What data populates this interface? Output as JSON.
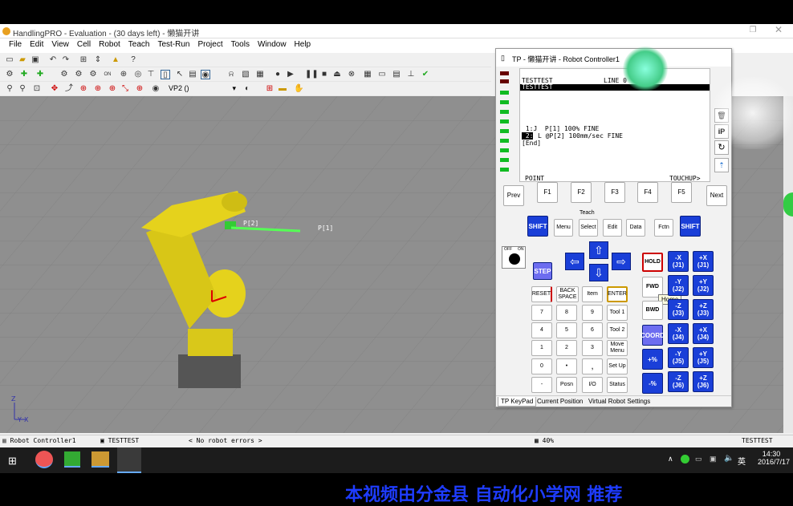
{
  "window": {
    "title": "HandlingPRO - Evaluation - (30 days left) - 懒猫开讲"
  },
  "menu": [
    "File",
    "Edit",
    "View",
    "Cell",
    "Robot",
    "Teach",
    "Test-Run",
    "Project",
    "Tools",
    "Window",
    "Help"
  ],
  "toolbar3": {
    "view_select": "VP2 ()"
  },
  "viewport": {
    "labels": {
      "p2": "P[2]",
      "p1": "P[1]",
      "axis_z": "Z",
      "axis_x": "X",
      "axis_y": "Y"
    }
  },
  "status": {
    "controller": "Robot Controller1",
    "program": "TESTTEST",
    "errors": "< No robot errors >",
    "zoom": "40%",
    "program_right": "TESTTEST"
  },
  "taskbar": {
    "time": "14:30",
    "date": "2016/7/17",
    "ime": "英"
  },
  "tp": {
    "title": "TP - 懒猫开讲 - Robot Controller1",
    "screen": {
      "line1": "TESTTEST",
      "line_label": "LINE 0",
      "line2": "TESTTEST",
      "code1": " 1:J  P[1] 100% FINE",
      "code2_num": " 2:",
      "code2": "L @P[2] 100mm/sec FINE",
      "end": "[End]",
      "point": "POINT",
      "touchup": "TOUCHUP>"
    },
    "fkeys": [
      "Prev",
      "F1",
      "F2",
      "F3",
      "F4",
      "F5",
      "Next"
    ],
    "teach_label": "Teach",
    "shift": "SHIFT",
    "menu_keys": [
      "Menu",
      "Select",
      "Edit",
      "Data",
      "Fctn"
    ],
    "onoff": {
      "off": "OFF",
      "on": "ON"
    },
    "step": "STEP",
    "hold": "HOLD",
    "fwd": "FWD",
    "bwd": "BWD",
    "coord": "COORD",
    "tooltip": "Home",
    "reset": "RESET",
    "backspace": "BACK SPACE",
    "item": "Item",
    "enter": "ENTER",
    "numpad": [
      [
        "7",
        "8",
        "9",
        "Tool 1"
      ],
      [
        "4",
        "5",
        "6",
        "Tool 2"
      ],
      [
        "1",
        "2",
        "3",
        "Move Menu"
      ],
      [
        "0",
        "•",
        ",",
        "Set Up"
      ],
      [
        "-",
        "Posn",
        "I/O",
        "Status"
      ]
    ],
    "jog": [
      [
        "-X\n(J1)",
        "+X\n(J1)"
      ],
      [
        "-Y\n(J2)",
        "+Y\n(J2)"
      ],
      [
        "-Z\n(J3)",
        "+Z\n(J3)"
      ],
      [
        "-X\n(J4)",
        "+X\n(J4)"
      ],
      [
        "-Y\n(J5)",
        "+Y\n(J5)"
      ],
      [
        "-Z\n(J6)",
        "+Z\n(J6)"
      ]
    ],
    "speed_up": "+%",
    "speed_down": "-%",
    "tabs": [
      "TP KeyPad",
      "Current Position",
      "Virtual Robot Settings"
    ]
  },
  "overlay_text": "本视频由分金县  自动化小学网 推荐",
  "colors": {
    "jog_blue": "#1a3fd8",
    "viewport_gray": "#8f8f8f",
    "robot_yellow": "#e5d21c"
  }
}
